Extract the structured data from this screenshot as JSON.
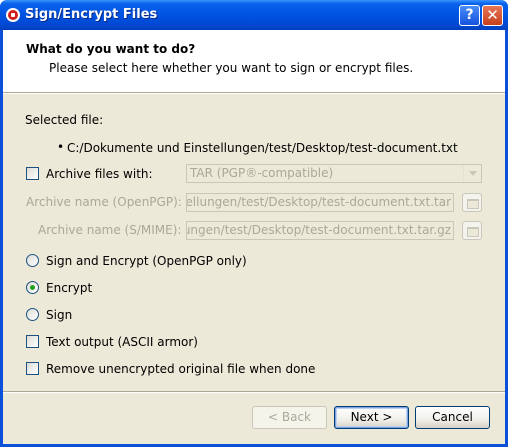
{
  "window": {
    "title": "Sign/Encrypt Files",
    "help_button": "?",
    "close_button": "✕"
  },
  "header": {
    "title": "What do you want to do?",
    "subtitle": "Please select here whether you want to sign or encrypt files."
  },
  "selected_file": {
    "label": "Selected file:",
    "bullet": "•",
    "path": "C:/Dokumente und Einstellungen/test/Desktop/test-document.txt"
  },
  "archive": {
    "checkbox_label": "Archive files with:",
    "checked": false,
    "format_selected": "TAR (PGP®-compatible)",
    "openpgp_label": "Archive name (OpenPGP):",
    "openpgp_value": "C:/Dokumente und Einstellungen/test/Desktop/test-document.txt.tar",
    "smime_label": "Archive name (S/MIME):",
    "smime_value": "C:/Dokumente und Einstellungen/test/Desktop/test-document.txt.tar.gz"
  },
  "options": {
    "sign_and_encrypt": "Sign and Encrypt (OpenPGP only)",
    "encrypt": "Encrypt",
    "sign": "Sign",
    "selected": "encrypt",
    "text_output": "Text output (ASCII armor)",
    "text_output_checked": false,
    "remove_unencrypted": "Remove unencrypted original file when done",
    "remove_unencrypted_checked": false
  },
  "buttons": {
    "back": "< Back",
    "next": "Next >",
    "cancel": "Cancel"
  },
  "colors": {
    "titlebar": "#0054e3",
    "dialog_bg": "#ece9d8",
    "radio_selected": "#21a121"
  }
}
